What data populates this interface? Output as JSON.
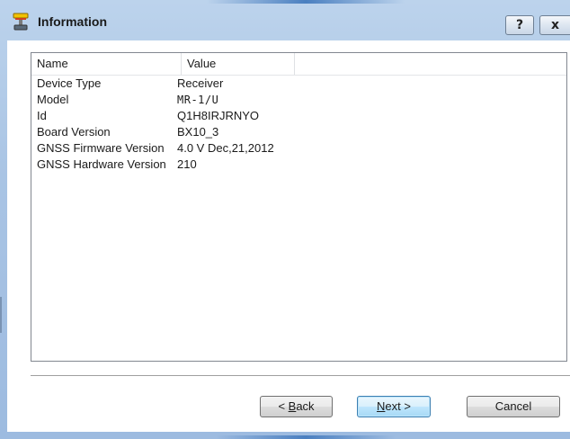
{
  "window": {
    "title": "Information",
    "help_label": "?",
    "close_label": "x"
  },
  "list": {
    "columns": [
      "Name",
      "Value"
    ],
    "rows": [
      {
        "name": "Device Type",
        "value": "Receiver"
      },
      {
        "name": "Model",
        "value": "MR-1/U"
      },
      {
        "name": "Id",
        "value": "Q1H8IRJRNYO"
      },
      {
        "name": "Board Version",
        "value": "BX10_3"
      },
      {
        "name": "GNSS Firmware Version",
        "value": "4.0 V Dec,21,2012"
      },
      {
        "name": "GNSS Hardware Version",
        "value": "210"
      }
    ]
  },
  "buttons": {
    "back": {
      "prefix": "< ",
      "mnemonic": "B",
      "rest": "ack"
    },
    "next": {
      "mnemonic": "N",
      "rest": "ext >"
    },
    "cancel": "Cancel"
  },
  "icons": {
    "app_icon": "receiver-device-icon"
  }
}
